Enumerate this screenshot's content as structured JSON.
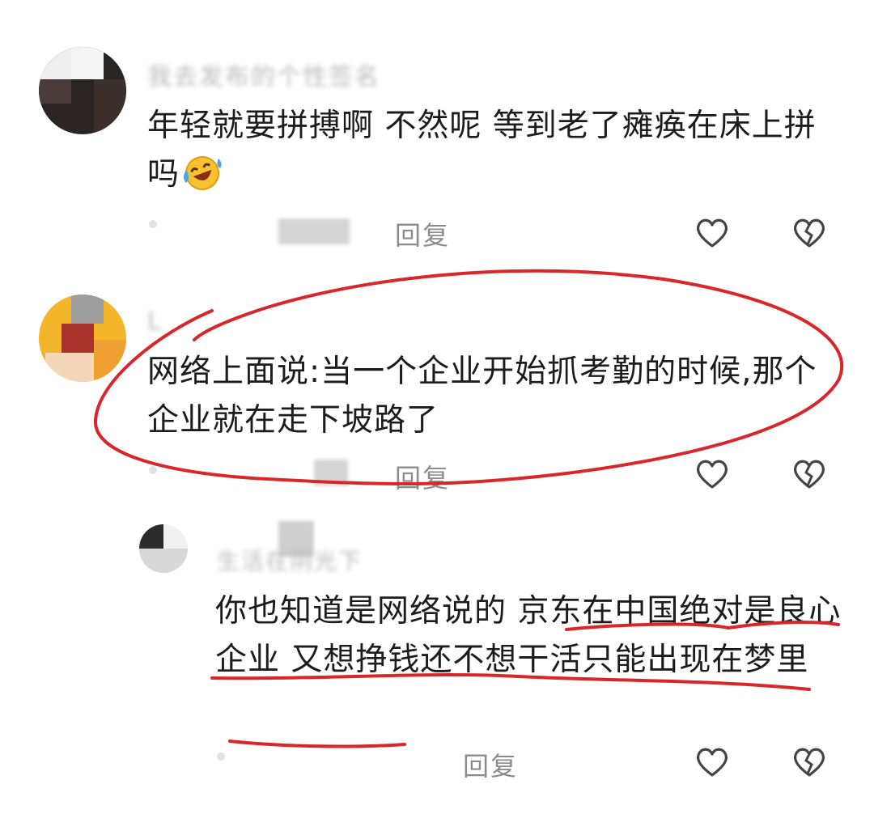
{
  "comments": [
    {
      "username": "我去发布的个性签名",
      "text": "年轻就要拼搏啊  不然呢  等到老了瘫痪在床上拼吗",
      "emoji": "rofl-emoji",
      "reply_label": "回复"
    },
    {
      "username": "L",
      "text": "网络上面说:当一个企业开始抓考勤的时候,那个企业就在走下坡路了",
      "reply_label": "回复"
    },
    {
      "username": "生活在阴光下",
      "text": "你也知道是网络说的  京东在中国绝对是良心企业  又想挣钱还不想干活只能出现在梦里",
      "reply_label": "回复"
    }
  ],
  "colors": {
    "annotation": "#d9262b",
    "reply": "#8c8c8c",
    "text": "#1c1c1c"
  },
  "icons": [
    "heart-outline-icon",
    "broken-heart-icon"
  ]
}
